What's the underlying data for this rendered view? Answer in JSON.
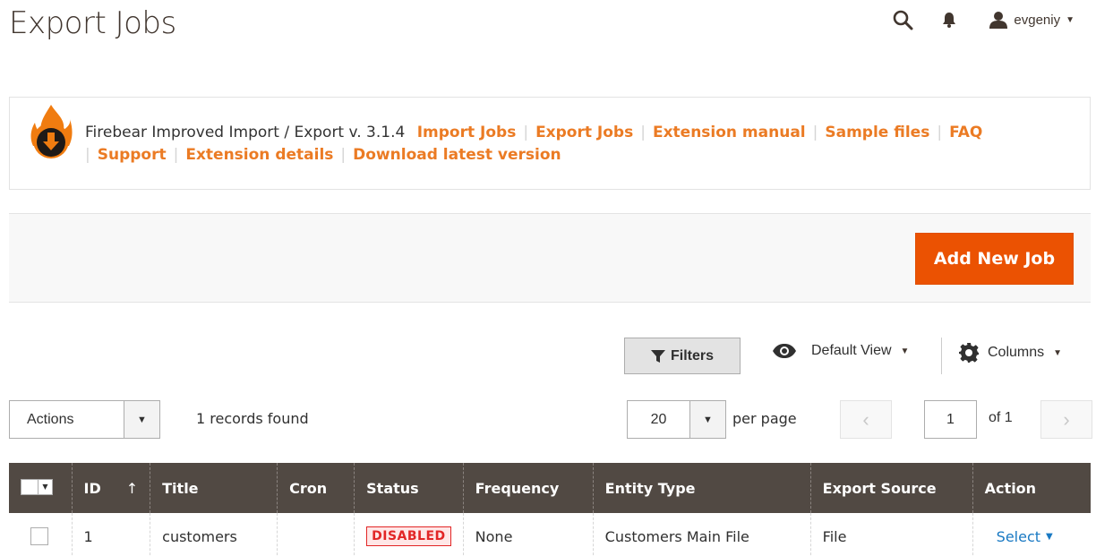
{
  "page": {
    "title": "Export Jobs"
  },
  "header": {
    "username": "evgeniy",
    "search_icon": "search-icon",
    "bell_icon": "bell-icon",
    "user_icon": "user-icon"
  },
  "banner": {
    "logo_icon": "firebear-logo-icon",
    "intro": "Firebear Improved Import / Export v. 3.1.4",
    "links": [
      "Import Jobs",
      "Export Jobs",
      "Extension manual",
      "Sample files",
      "FAQ",
      "Support",
      "Extension details",
      "Download latest version"
    ],
    "link_color": "#eb7b24"
  },
  "toolbar": {
    "add_new_label": "Add New Job",
    "primary_color": "#eb5202"
  },
  "grid_tools": {
    "filters_label": "Filters",
    "view_label": "Default View",
    "columns_label": "Columns"
  },
  "grid_controls": {
    "actions_label": "Actions",
    "records_found": "1 records found",
    "per_page_value": "20",
    "per_page_label": "per page",
    "page_current": "1",
    "page_total": "of 1"
  },
  "table": {
    "headers": [
      "ID",
      "Title",
      "Cron",
      "Status",
      "Frequency",
      "Entity Type",
      "Export Source",
      "Action"
    ],
    "sort_indicator": "↑",
    "rows": [
      {
        "id": "1",
        "title": "customers",
        "cron": "",
        "status": "DISABLED",
        "frequency": "None",
        "entity_type": "Customers Main File",
        "export_source": "File",
        "action": "Select"
      }
    ]
  }
}
